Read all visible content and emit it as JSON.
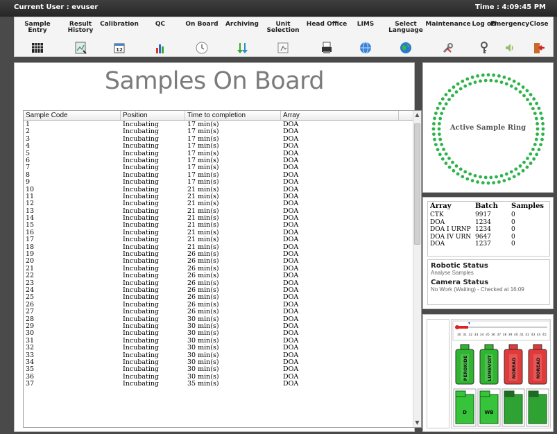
{
  "titlebar": {
    "user": "Current User : evuser",
    "time": "Time : 4:09:45 PM"
  },
  "toolbar": {
    "buttons": [
      {
        "label": "Sample Entry",
        "icon": "grid-icon"
      },
      {
        "label": "Result History",
        "icon": "report-icon"
      },
      {
        "label": "Calibration",
        "icon": "calendar-icon"
      },
      {
        "label": "QC",
        "icon": "bar-chart-icon"
      },
      {
        "label": "On Board",
        "icon": "clock-icon"
      },
      {
        "label": "Archiving",
        "icon": "arrows-down-icon"
      },
      {
        "label": "Unit Selection",
        "icon": "hand-icon"
      },
      {
        "label": "Head Office",
        "icon": "printer-icon"
      },
      {
        "label": "LIMS",
        "icon": "globe-icon"
      },
      {
        "label": "Select Language",
        "icon": "earth-icon"
      },
      {
        "label": "Maintenance",
        "icon": "tools-icon"
      },
      {
        "label": "Log off",
        "icon": "key-icon"
      },
      {
        "label": "Emergency",
        "icon": "speaker-icon"
      },
      {
        "label": "Close",
        "icon": "exit-door-icon"
      }
    ]
  },
  "main": {
    "title": "Samples On Board",
    "columns": [
      "Sample Code",
      "Position",
      "Time to completion",
      "Array"
    ],
    "rows": [
      [
        "1",
        "Incubating",
        "17 min(s)",
        "DOA"
      ],
      [
        "2",
        "Incubating",
        "17 min(s)",
        "DOA"
      ],
      [
        "3",
        "Incubating",
        "17 min(s)",
        "DOA"
      ],
      [
        "4",
        "Incubating",
        "17 min(s)",
        "DOA"
      ],
      [
        "5",
        "Incubating",
        "17 min(s)",
        "DOA"
      ],
      [
        "6",
        "Incubating",
        "17 min(s)",
        "DOA"
      ],
      [
        "7",
        "Incubating",
        "17 min(s)",
        "DOA"
      ],
      [
        "8",
        "Incubating",
        "17 min(s)",
        "DOA"
      ],
      [
        "9",
        "Incubating",
        "17 min(s)",
        "DOA"
      ],
      [
        "10",
        "Incubating",
        "21 min(s)",
        "DOA"
      ],
      [
        "11",
        "Incubating",
        "21 min(s)",
        "DOA"
      ],
      [
        "12",
        "Incubating",
        "21 min(s)",
        "DOA"
      ],
      [
        "13",
        "Incubating",
        "21 min(s)",
        "DOA"
      ],
      [
        "14",
        "Incubating",
        "21 min(s)",
        "DOA"
      ],
      [
        "15",
        "Incubating",
        "21 min(s)",
        "DOA"
      ],
      [
        "16",
        "Incubating",
        "21 min(s)",
        "DOA"
      ],
      [
        "17",
        "Incubating",
        "21 min(s)",
        "DOA"
      ],
      [
        "18",
        "Incubating",
        "21 min(s)",
        "DOA"
      ],
      [
        "19",
        "Incubating",
        "26 min(s)",
        "DOA"
      ],
      [
        "20",
        "Incubating",
        "26 min(s)",
        "DOA"
      ],
      [
        "21",
        "Incubating",
        "26 min(s)",
        "DOA"
      ],
      [
        "22",
        "Incubating",
        "26 min(s)",
        "DOA"
      ],
      [
        "23",
        "Incubating",
        "26 min(s)",
        "DOA"
      ],
      [
        "24",
        "Incubating",
        "26 min(s)",
        "DOA"
      ],
      [
        "25",
        "Incubating",
        "26 min(s)",
        "DOA"
      ],
      [
        "26",
        "Incubating",
        "26 min(s)",
        "DOA"
      ],
      [
        "27",
        "Incubating",
        "26 min(s)",
        "DOA"
      ],
      [
        "28",
        "Incubating",
        "30 min(s)",
        "DOA"
      ],
      [
        "29",
        "Incubating",
        "30 min(s)",
        "DOA"
      ],
      [
        "30",
        "Incubating",
        "30 min(s)",
        "DOA"
      ],
      [
        "31",
        "Incubating",
        "30 min(s)",
        "DOA"
      ],
      [
        "32",
        "Incubating",
        "30 min(s)",
        "DOA"
      ],
      [
        "33",
        "Incubating",
        "30 min(s)",
        "DOA"
      ],
      [
        "34",
        "Incubating",
        "30 min(s)",
        "DOA"
      ],
      [
        "35",
        "Incubating",
        "30 min(s)",
        "DOA"
      ],
      [
        "36",
        "Incubating",
        "30 min(s)",
        "DOA"
      ],
      [
        "37",
        "Incubating",
        "35 min(s)",
        "DOA"
      ]
    ]
  },
  "ring": {
    "label": "Active Sample Ring",
    "dot_color": "#2db34a"
  },
  "batch": {
    "columns": [
      "Array",
      "Batch",
      "Samples"
    ],
    "rows": [
      [
        "CTK",
        "9917",
        "0"
      ],
      [
        "DOA",
        "1234",
        "0"
      ],
      [
        "DOA I URNP",
        "1234",
        "0"
      ],
      [
        "DOA IV URN",
        "9647",
        "0"
      ],
      [
        "DOA",
        "1237",
        "0"
      ]
    ]
  },
  "status": {
    "robotic_title": "Robotic Status",
    "robotic_text": "Analyse Samples",
    "camera_title": "Camera Status",
    "camera_text": "No Work (Waiting) - Checked at 16:09"
  },
  "reagents": {
    "bottles": [
      {
        "label": "PEROXIDE",
        "color": "#2fb52f"
      },
      {
        "label": "LUMEVDIT",
        "color": "#2fb52f"
      },
      {
        "label": "NOREAD",
        "color": "#e03a3a"
      },
      {
        "label": "NOREAD",
        "color": "#e03a3a"
      }
    ],
    "waste": [
      {
        "label": "D"
      },
      {
        "label": "WB"
      },
      {
        "label": ""
      },
      {
        "label": ""
      }
    ],
    "temperature_ticks": [
      "30",
      "31",
      "32",
      "33",
      "34",
      "35",
      "36",
      "37",
      "38",
      "39",
      "40",
      "41",
      "42",
      "43",
      "44",
      "45"
    ]
  }
}
